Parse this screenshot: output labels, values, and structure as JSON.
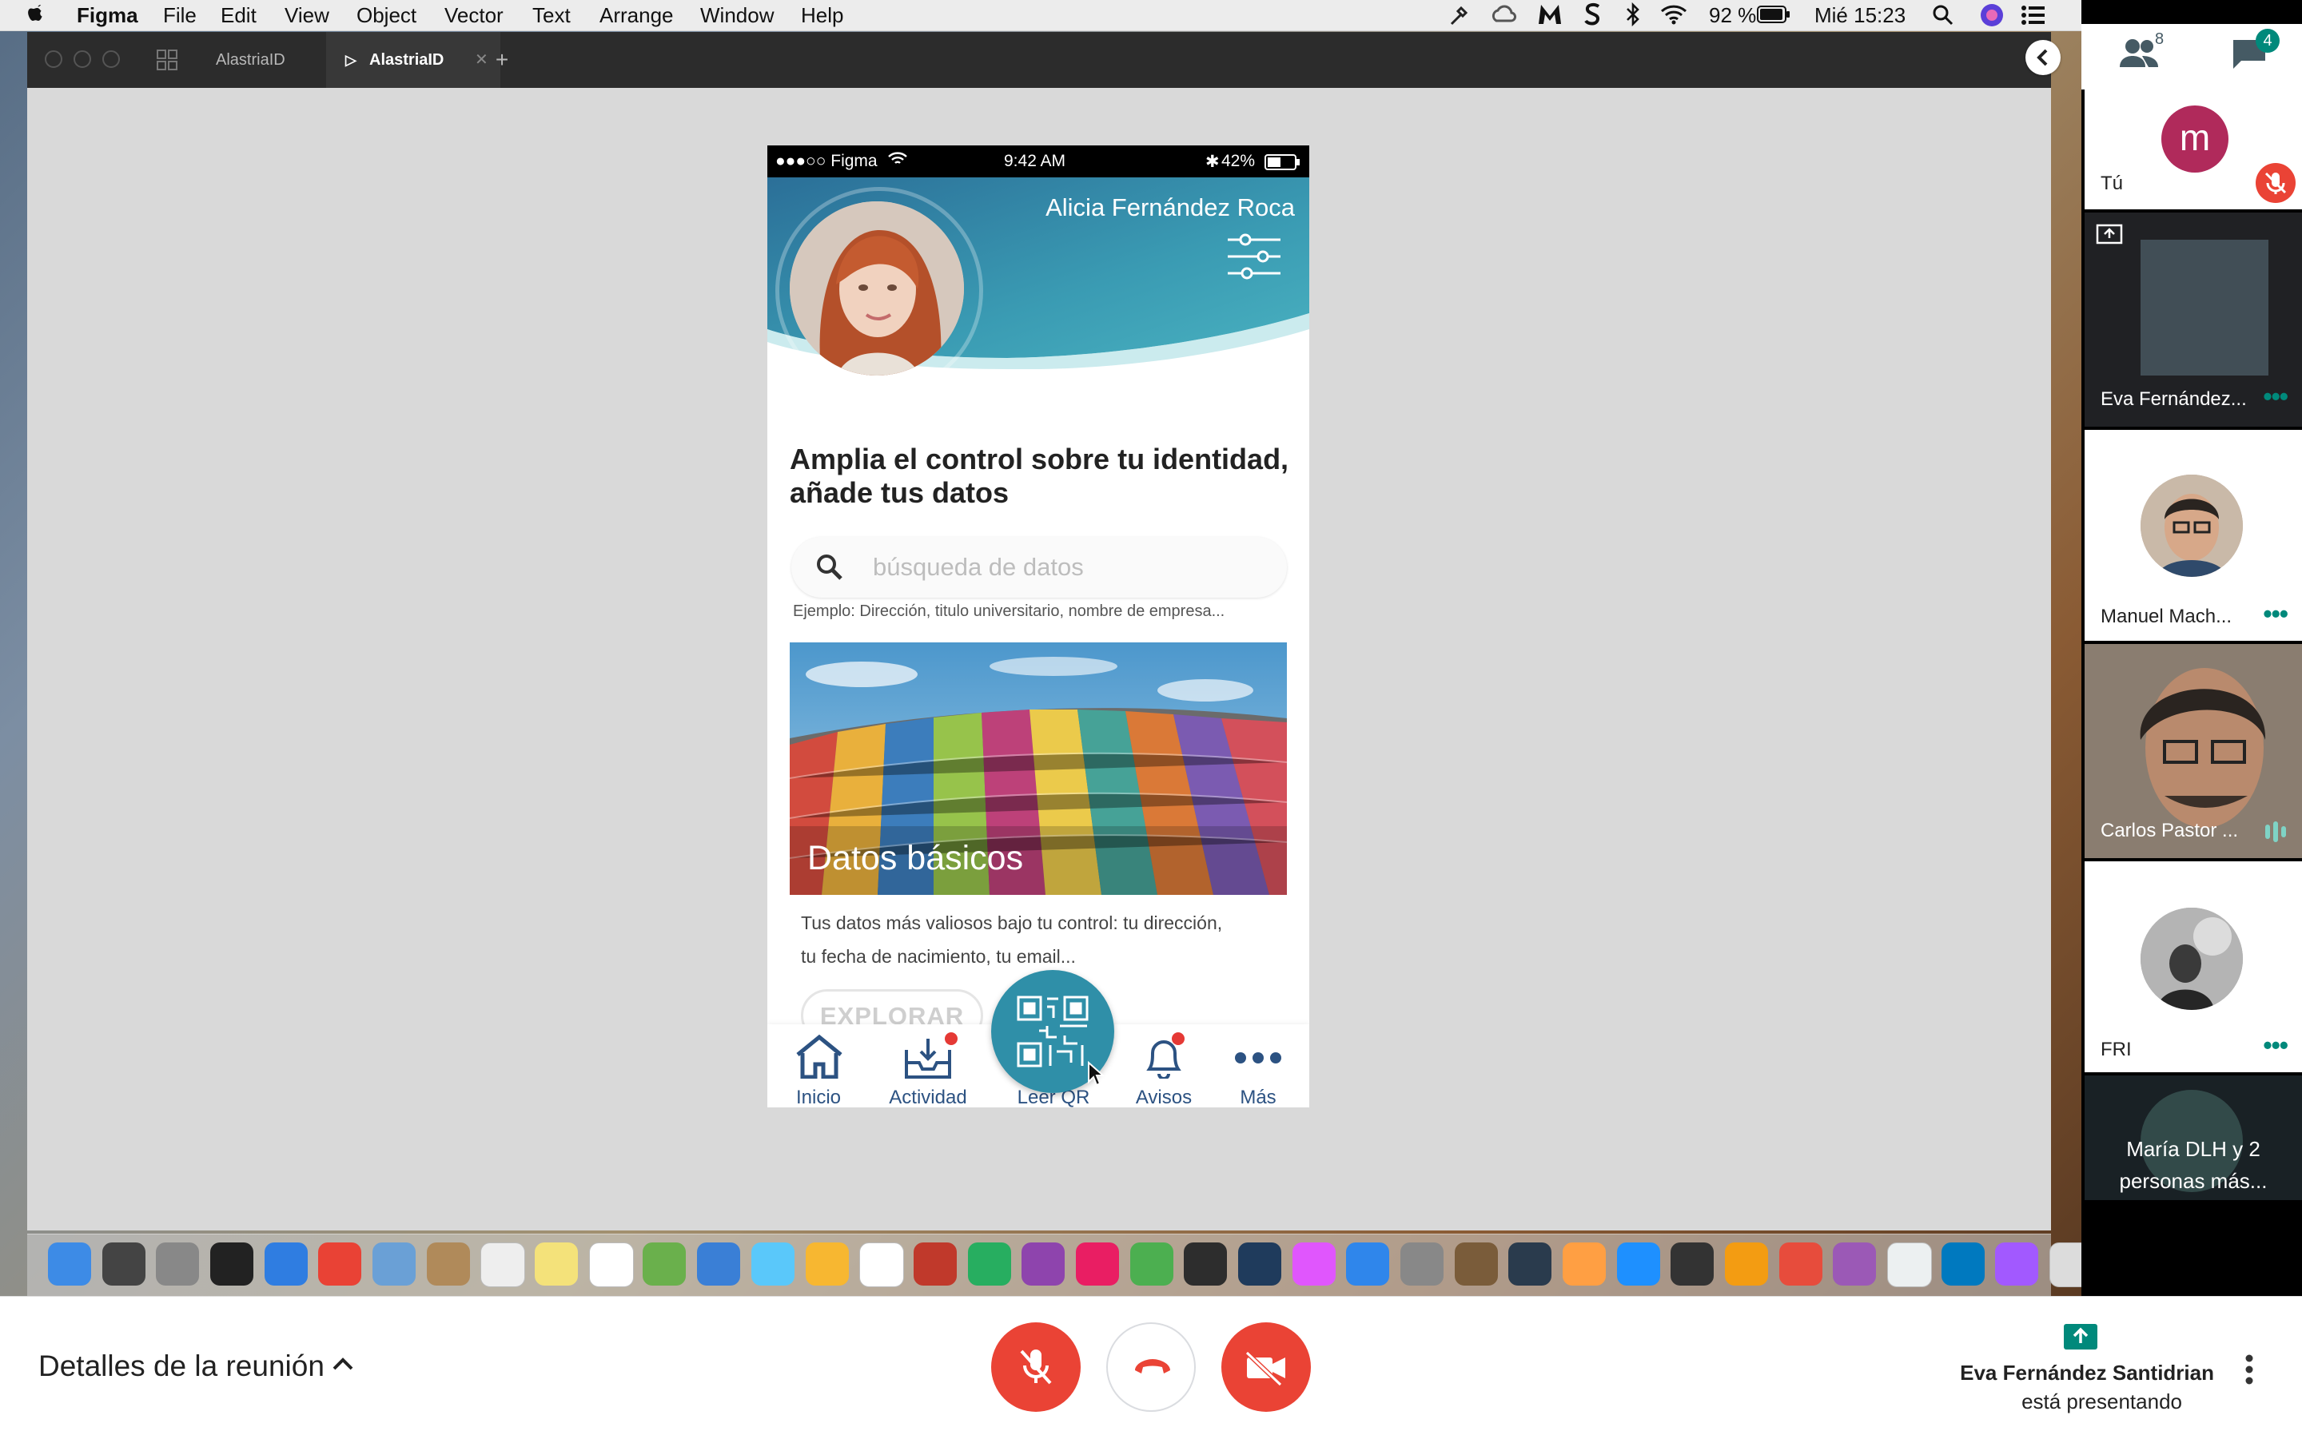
{
  "menubar": {
    "apple": "",
    "items": [
      "Figma",
      "File",
      "Edit",
      "View",
      "Object",
      "Vector",
      "Text",
      "Arrange",
      "Window",
      "Help"
    ],
    "battery": "92 %",
    "clock": "Mié 15:23"
  },
  "figma": {
    "tabs": [
      "AlastriaID",
      "AlastriaID"
    ],
    "new_tab": "+"
  },
  "phone": {
    "status": {
      "carrier": "●●●○○ Figma",
      "time": "9:42 AM",
      "battery": "42%"
    },
    "user_name": "Alicia Fernández Roca",
    "heading": "Amplia el control sobre tu identidad, añade tus datos",
    "search": {
      "placeholder": "búsqueda de datos"
    },
    "example": "Ejemplo: Dirección, titulo universitario, nombre de empresa...",
    "card": {
      "title": "Datos básicos",
      "description": "Tus datos más valiosos bajo tu control: tu dirección, tu fecha de nacimiento, tu email...",
      "button": "EXPLORAR"
    },
    "nav": [
      {
        "label": "Inicio",
        "icon": "home-icon"
      },
      {
        "label": "Actividad",
        "icon": "inbox-download-icon"
      },
      {
        "label": "Leer QR",
        "icon": "qr-code-icon"
      },
      {
        "label": "Avisos",
        "icon": "bell-icon"
      },
      {
        "label": "Más",
        "icon": "more-dots-icon"
      }
    ]
  },
  "panel": {
    "people_count": "8",
    "chat_count": "4",
    "participants": [
      {
        "name": "Tú",
        "avatar_letter": "m"
      },
      {
        "name": "Eva Fernández..."
      },
      {
        "name": "Manuel Mach..."
      },
      {
        "name": "Carlos Pastor ..."
      },
      {
        "name": "FRI"
      },
      {
        "name": "María DLH y 2 personas más..."
      }
    ]
  },
  "meet": {
    "details": "Detalles de la reunión",
    "presenter_name": "Eva Fernández Santidrian",
    "presenter_status": "está presentando"
  },
  "colors": {
    "teal": "#00897b",
    "phone_header": "#2f8fa8",
    "nav_blue": "#2c5282",
    "danger_red": "#ea4335"
  }
}
